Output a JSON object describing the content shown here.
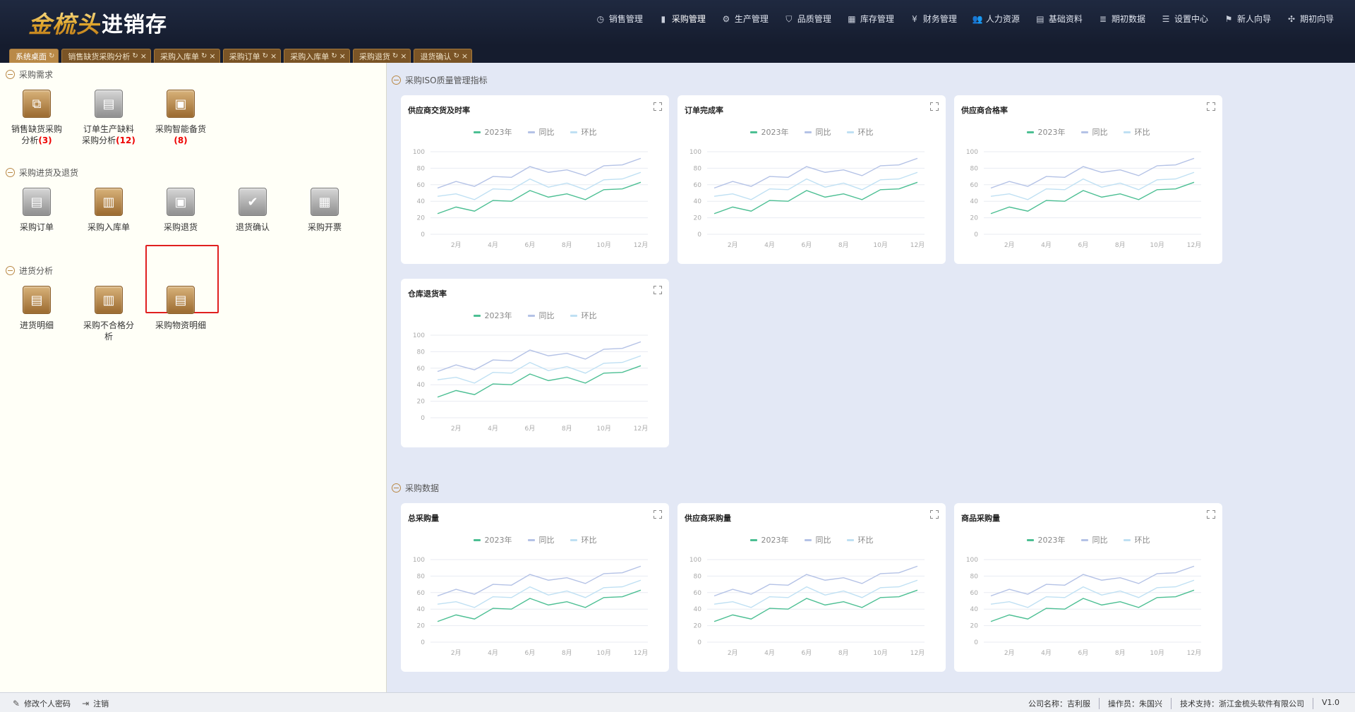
{
  "app": {
    "logo_gold": "金梳头",
    "logo_white": "进销存"
  },
  "topnav": [
    {
      "label": "销售管理",
      "icon": "clock-icon"
    },
    {
      "label": "采购管理",
      "icon": "doc-icon"
    },
    {
      "label": "生产管理",
      "icon": "gear-icon"
    },
    {
      "label": "品质管理",
      "icon": "shield-icon"
    },
    {
      "label": "库存管理",
      "icon": "grid-icon"
    },
    {
      "label": "财务管理",
      "icon": "yen-icon"
    },
    {
      "label": "人力资源",
      "icon": "users-icon"
    },
    {
      "label": "基础资料",
      "icon": "book-icon"
    },
    {
      "label": "期初数据",
      "icon": "database-icon"
    },
    {
      "label": "设置中心",
      "icon": "sliders-icon"
    },
    {
      "label": "新人向导",
      "icon": "flag-icon"
    },
    {
      "label": "期初向导",
      "icon": "compass-icon"
    }
  ],
  "tabs": [
    {
      "label": "系统桌面"
    },
    {
      "label": "销售缺货采购分析"
    },
    {
      "label": "采购入库单"
    },
    {
      "label": "采购订单"
    },
    {
      "label": "采购入库单"
    },
    {
      "label": "采购退货"
    },
    {
      "label": "退货确认"
    }
  ],
  "left": {
    "sections": [
      {
        "title": "采购需求",
        "items": [
          {
            "line1": "销售缺货采购",
            "line2": "分析",
            "count": "(3)"
          },
          {
            "line1": "订单生产缺料",
            "line2": "采购分析",
            "count": "(12)"
          },
          {
            "line1": "采购智能备货",
            "line2": "",
            "count": "(8)"
          }
        ]
      },
      {
        "title": "采购进货及退货",
        "items": [
          {
            "line1": "采购订单"
          },
          {
            "line1": "采购入库单"
          },
          {
            "line1": "采购退货"
          },
          {
            "line1": "退货确认"
          },
          {
            "line1": "采购开票"
          }
        ]
      },
      {
        "title": "进货分析",
        "items": [
          {
            "line1": "进货明细"
          },
          {
            "line1": "采购不合格分",
            "line2": "析"
          },
          {
            "line1": "采购物资明细"
          }
        ]
      }
    ]
  },
  "right": {
    "section1_title": "采购ISO质量管理指标",
    "section2_title": "采购数据",
    "cards": [
      {
        "title": "供应商交货及时率"
      },
      {
        "title": "订单完成率"
      },
      {
        "title": "供应商合格率"
      },
      {
        "title": "仓库退货率"
      },
      {
        "title": "总采购量"
      },
      {
        "title": "供应商采购量"
      },
      {
        "title": "商品采购量"
      }
    ]
  },
  "chart_data": {
    "type": "line",
    "x": [
      "1月",
      "2月",
      "3月",
      "4月",
      "5月",
      "6月",
      "7月",
      "8月",
      "9月",
      "10月",
      "11月",
      "12月"
    ],
    "x_tick_labels": [
      "2月",
      "4月",
      "6月",
      "8月",
      "10月",
      "12月"
    ],
    "ylim": [
      0,
      100
    ],
    "y_ticks": [
      "0",
      "20",
      "40",
      "60",
      "80",
      "100"
    ],
    "legend_position": "top-center",
    "grid": true,
    "series": [
      {
        "name": "2023年",
        "color": "#4cbf93",
        "values": [
          25,
          33,
          28,
          41,
          40,
          53,
          45,
          49,
          42,
          54,
          55,
          63
        ]
      },
      {
        "name": "同比",
        "color": "#b4c2e6",
        "values": [
          56,
          64,
          58,
          70,
          69,
          82,
          75,
          78,
          71,
          83,
          84,
          92
        ]
      },
      {
        "name": "环比",
        "color": "#bfe0f3",
        "values": [
          46,
          49,
          42,
          55,
          54,
          67,
          57,
          62,
          54,
          66,
          67,
          75
        ]
      }
    ]
  },
  "status": {
    "change_password": "修改个人密码",
    "logout": "注销",
    "company": "公司名称：吉利服",
    "operator": "操作员：朱国兴",
    "support": "技术支持：浙江金梳头软件有限公司",
    "version": "V1.0"
  }
}
